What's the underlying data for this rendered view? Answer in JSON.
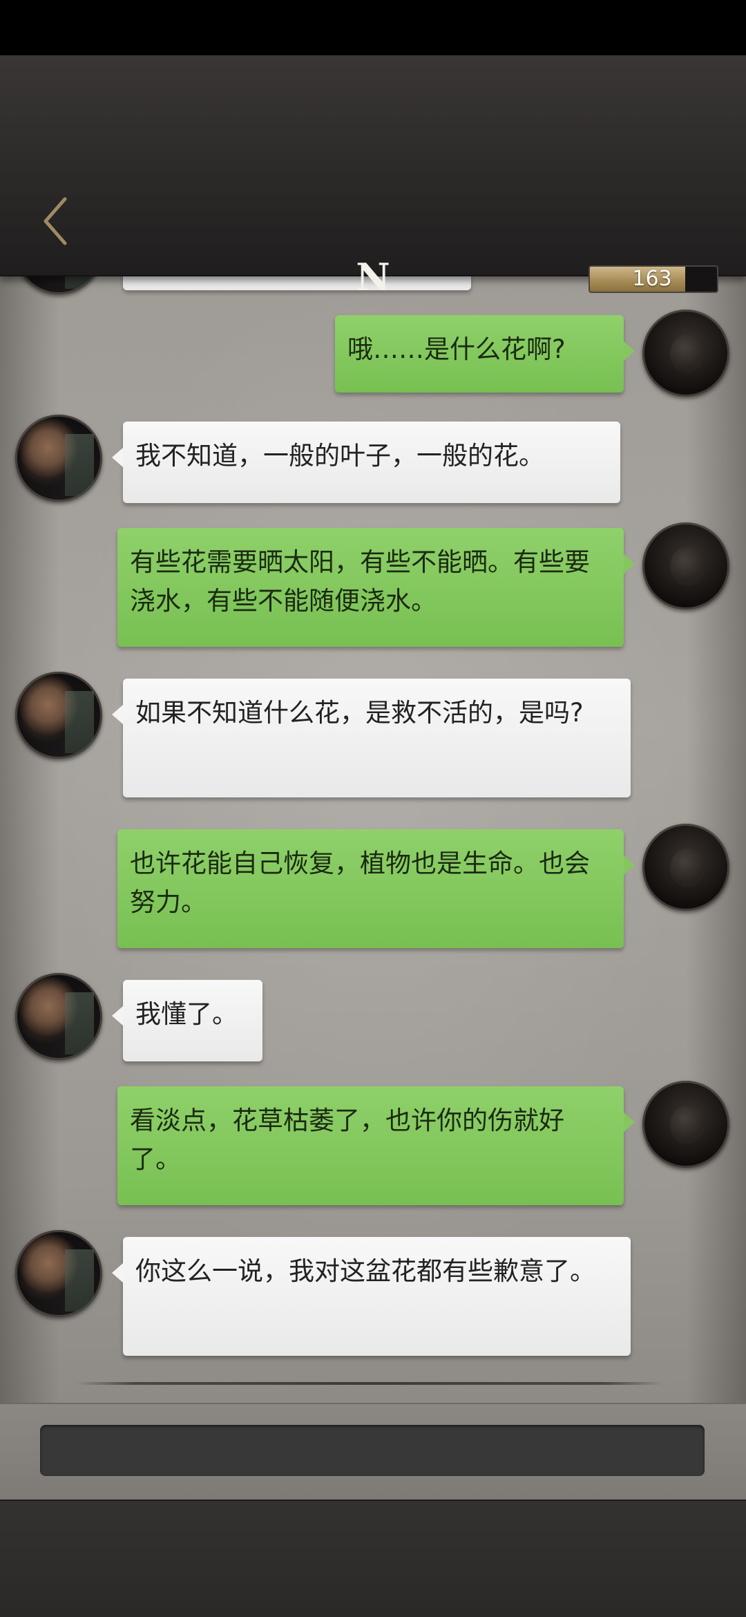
{
  "header": {
    "back_icon": "chevron-left-icon",
    "title": "N",
    "energy": {
      "value": "163",
      "fill_fraction": 0.75,
      "color": "#a68a55"
    }
  },
  "conversation": {
    "messages": [
      {
        "sender": "player",
        "text": "哦……是什么花啊?"
      },
      {
        "sender": "npc",
        "text": "我不知道，一般的叶子，一般的花。"
      },
      {
        "sender": "player",
        "text": "有些花需要晒太阳，有些不能晒。有些要浇水，有些不能随便浇水。"
      },
      {
        "sender": "npc",
        "text": "如果不知道什么花，是救不活的，是吗?"
      },
      {
        "sender": "player",
        "text": "也许花能自己恢复，植物也是生命。也会努力。"
      },
      {
        "sender": "npc",
        "text": "我懂了。"
      },
      {
        "sender": "player",
        "text": "看淡点，花草枯萎了，也许你的伤就好了。"
      },
      {
        "sender": "npc",
        "text": "你这么一说，我对这盆花都有些歉意了。"
      }
    ]
  },
  "colors": {
    "player_bubble": "#85c75e",
    "npc_bubble": "#f4f4f4",
    "header_bg": "#2c2929"
  }
}
